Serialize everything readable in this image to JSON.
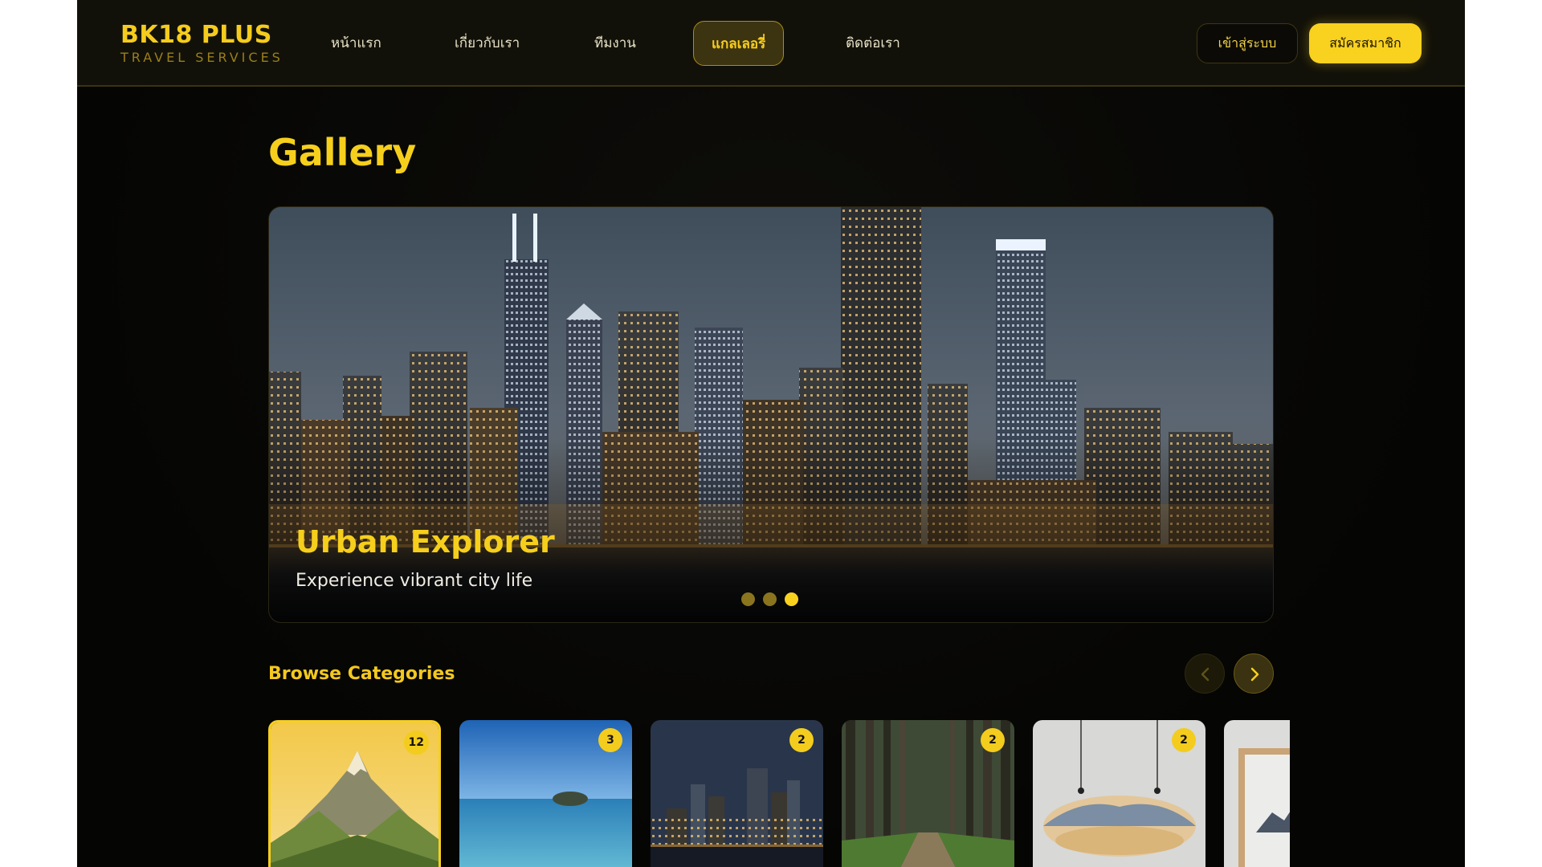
{
  "brand": {
    "name": "BK18 PLUS",
    "tagline": "TRAVEL SERVICES"
  },
  "nav": {
    "items": [
      {
        "label": "หน้าแรก",
        "active": false
      },
      {
        "label": "เกี่ยวกับเรา",
        "active": false
      },
      {
        "label": "ทีมงาน",
        "active": false
      },
      {
        "label": "แกลเลอรี่",
        "active": true
      },
      {
        "label": "ติดต่อเรา",
        "active": false
      }
    ],
    "login_label": "เข้าสู่ระบบ",
    "register_label": "สมัครสมาชิก"
  },
  "page": {
    "title": "Gallery"
  },
  "hero": {
    "title": "Urban Explorer",
    "subtitle": "Experience vibrant city life",
    "slide_count": 3,
    "active_slide": 3
  },
  "categories": {
    "title": "Browse Categories",
    "items": [
      {
        "image": "mountain-landscape",
        "count": "12",
        "selected": true
      },
      {
        "image": "ocean-island",
        "count": "3",
        "selected": false
      },
      {
        "image": "city-night-skyline",
        "count": "2",
        "selected": false
      },
      {
        "image": "forest-path",
        "count": "2",
        "selected": false
      },
      {
        "image": "hanging-desert-art",
        "count": "2",
        "selected": false
      },
      {
        "image": "framed-mountain-art",
        "count": "",
        "selected": false
      }
    ]
  },
  "colors": {
    "accent": "#f8d11f",
    "background": "#070705",
    "nav_background": "#121109",
    "text_light": "#f0ede4"
  }
}
